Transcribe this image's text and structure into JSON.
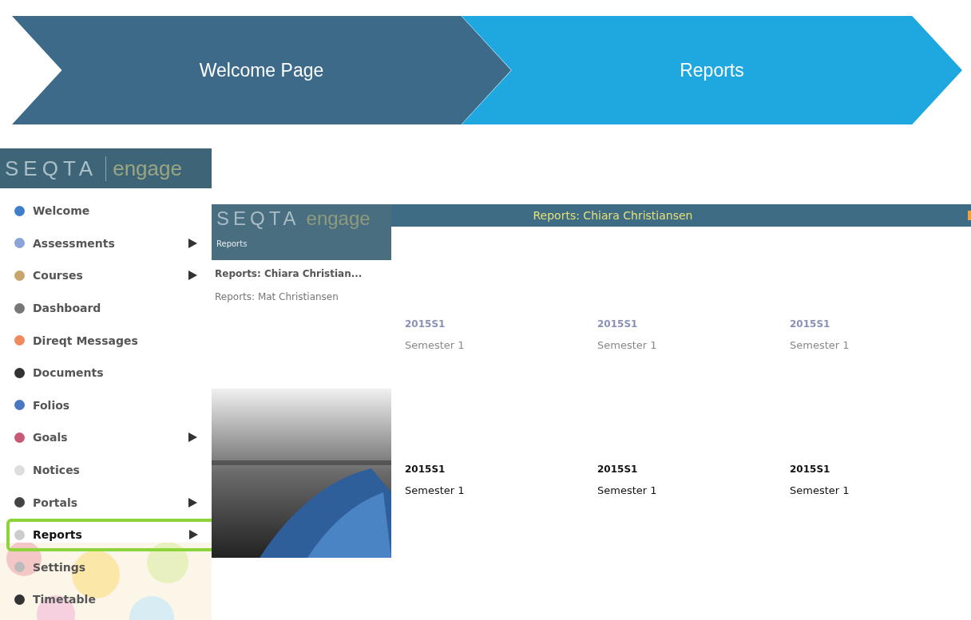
{
  "steps": [
    {
      "label": "Welcome Page",
      "selected": false
    },
    {
      "label": "Reports",
      "selected": true
    }
  ],
  "sidebar": {
    "logo": {
      "left": "SEQTA",
      "right": "engage"
    },
    "items": [
      {
        "label": "Welcome",
        "color": "#3f7fc9",
        "submenu": false,
        "selected": false
      },
      {
        "label": "Assessments",
        "color": "#8aa3d8",
        "submenu": true,
        "selected": false
      },
      {
        "label": "Courses",
        "color": "#c8a56a",
        "submenu": true,
        "selected": false
      },
      {
        "label": "Dashboard",
        "color": "#777777",
        "submenu": false,
        "selected": false
      },
      {
        "label": "Direqt Messages",
        "color": "#f08a5d",
        "submenu": false,
        "selected": false
      },
      {
        "label": "Documents",
        "color": "#333333",
        "submenu": false,
        "selected": false
      },
      {
        "label": "Folios",
        "color": "#4a78c0",
        "submenu": false,
        "selected": false
      },
      {
        "label": "Goals",
        "color": "#c85a78",
        "submenu": true,
        "selected": false
      },
      {
        "label": "Notices",
        "color": "#dddddd",
        "submenu": false,
        "selected": false
      },
      {
        "label": "Portals",
        "color": "#444444",
        "submenu": true,
        "selected": false
      },
      {
        "label": "Reports",
        "color": "#cccccc",
        "submenu": true,
        "selected": true
      },
      {
        "label": "Settings",
        "color": "#bbbbbb",
        "submenu": false,
        "selected": false
      },
      {
        "label": "Timetable",
        "color": "#333333",
        "submenu": false,
        "selected": false
      }
    ]
  },
  "app": {
    "logo": {
      "left": "SEQTA",
      "right": "engage"
    },
    "breadcrumb": "Reports",
    "title": "Reports: Chiara Christiansen",
    "students": [
      "Reports: Chiara Christian...",
      "Reports: Mat Christiansen"
    ],
    "report_rows": [
      {
        "muted": true,
        "reports": [
          {
            "code": "2015S1",
            "name": "Semester 1"
          },
          {
            "code": "2015S1",
            "name": "Semester 1"
          },
          {
            "code": "2015S1",
            "name": "Semester 1"
          }
        ]
      },
      {
        "muted": false,
        "reports": [
          {
            "code": "2015S1",
            "name": "Semester 1"
          },
          {
            "code": "2015S1",
            "name": "Semester 1"
          },
          {
            "code": "2015S1",
            "name": "Semester 1"
          }
        ]
      }
    ]
  }
}
